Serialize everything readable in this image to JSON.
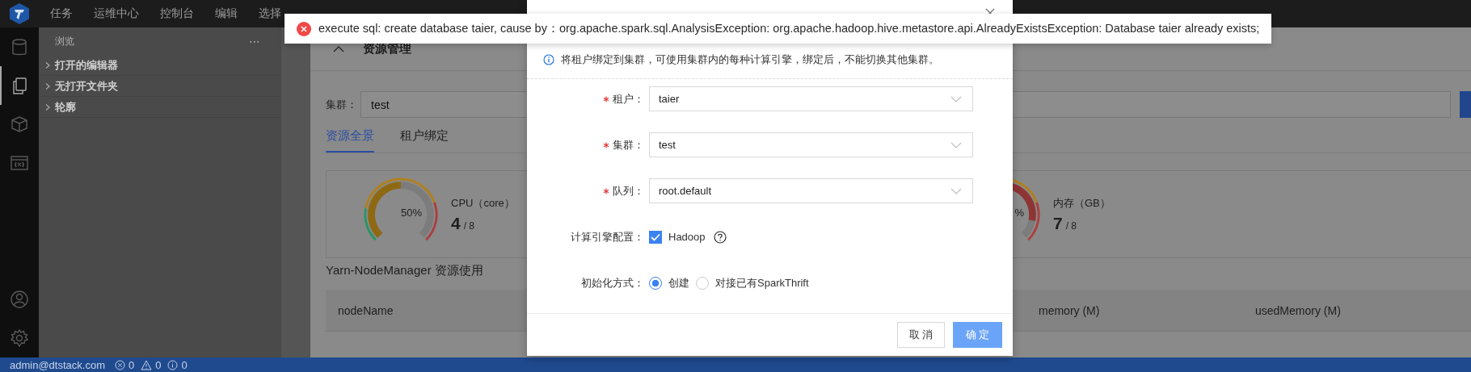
{
  "menu_bar": {
    "items": [
      "任务",
      "运维中心",
      "控制台",
      "编辑",
      "选择"
    ]
  },
  "activity_bar": {
    "top": [
      {
        "kind": "database",
        "selected": false
      },
      {
        "kind": "files",
        "selected": true
      },
      {
        "kind": "cube",
        "selected": false
      },
      {
        "kind": "variable",
        "selected": false
      }
    ],
    "bottom": [
      {
        "kind": "account",
        "selected": false
      },
      {
        "kind": "settings",
        "selected": false
      }
    ]
  },
  "sidebar": {
    "title": "浏览",
    "more": "⋯",
    "sections": [
      {
        "label": "打开的编辑器",
        "expanded": false
      },
      {
        "label": "无打开文件夹",
        "expanded": false
      },
      {
        "label": "轮廓",
        "expanded": false
      }
    ]
  },
  "panel": {
    "title": "资源管理",
    "cluster": {
      "label": "集群：",
      "value": "test"
    },
    "tabs": [
      {
        "label": "资源全景",
        "selected": true
      },
      {
        "label": "租户绑定",
        "selected": false
      }
    ],
    "gauges": [
      {
        "percent": "50%",
        "level": 0.5,
        "title": "CPU（core）",
        "used": "4",
        "total": "/ 8"
      },
      {
        "percent": "%",
        "title": "内存（GB）",
        "used": "7",
        "total": "/ 8"
      }
    ],
    "section_title": "Yarn-NodeManager 资源使用",
    "table": {
      "columns": [
        "nodeName",
        "memory (M)",
        "usedMemory (M)"
      ]
    }
  },
  "dialog": {
    "info": "将租户绑定到集群，可使用集群内的每种计算引擎，绑定后，不能切换其他集群。",
    "fields": [
      {
        "kind": "select",
        "label": "租户：",
        "required": true,
        "value": "taier"
      },
      {
        "kind": "select",
        "label": "集群：",
        "required": true,
        "value": "test"
      },
      {
        "kind": "select",
        "label": "队列：",
        "required": true,
        "value": "root.default"
      },
      {
        "kind": "checkbox",
        "label": "计算引擎配置：",
        "required": false,
        "option": "Hadoop",
        "checked": true
      },
      {
        "kind": "radio",
        "label": "初始化方式：",
        "required": false,
        "options": [
          {
            "label": "创建",
            "selected": true
          },
          {
            "label": "对接已有SparkThrift",
            "selected": false
          }
        ]
      }
    ],
    "buttons": [
      {
        "label": "取 消",
        "kind": "default"
      },
      {
        "label": "确 定",
        "kind": "primary"
      }
    ]
  },
  "toast": {
    "kind": "error",
    "message": "execute sql: create database taier, cause by：org.apache.spark.sql.AnalysisException: org.apache.hadoop.hive.metastore.api.AlreadyExistsException: Database taier already exists;"
  },
  "status_bar": {
    "user": "admin@dtstack.com",
    "errors": "0",
    "warnings": "0",
    "infos": "0"
  }
}
